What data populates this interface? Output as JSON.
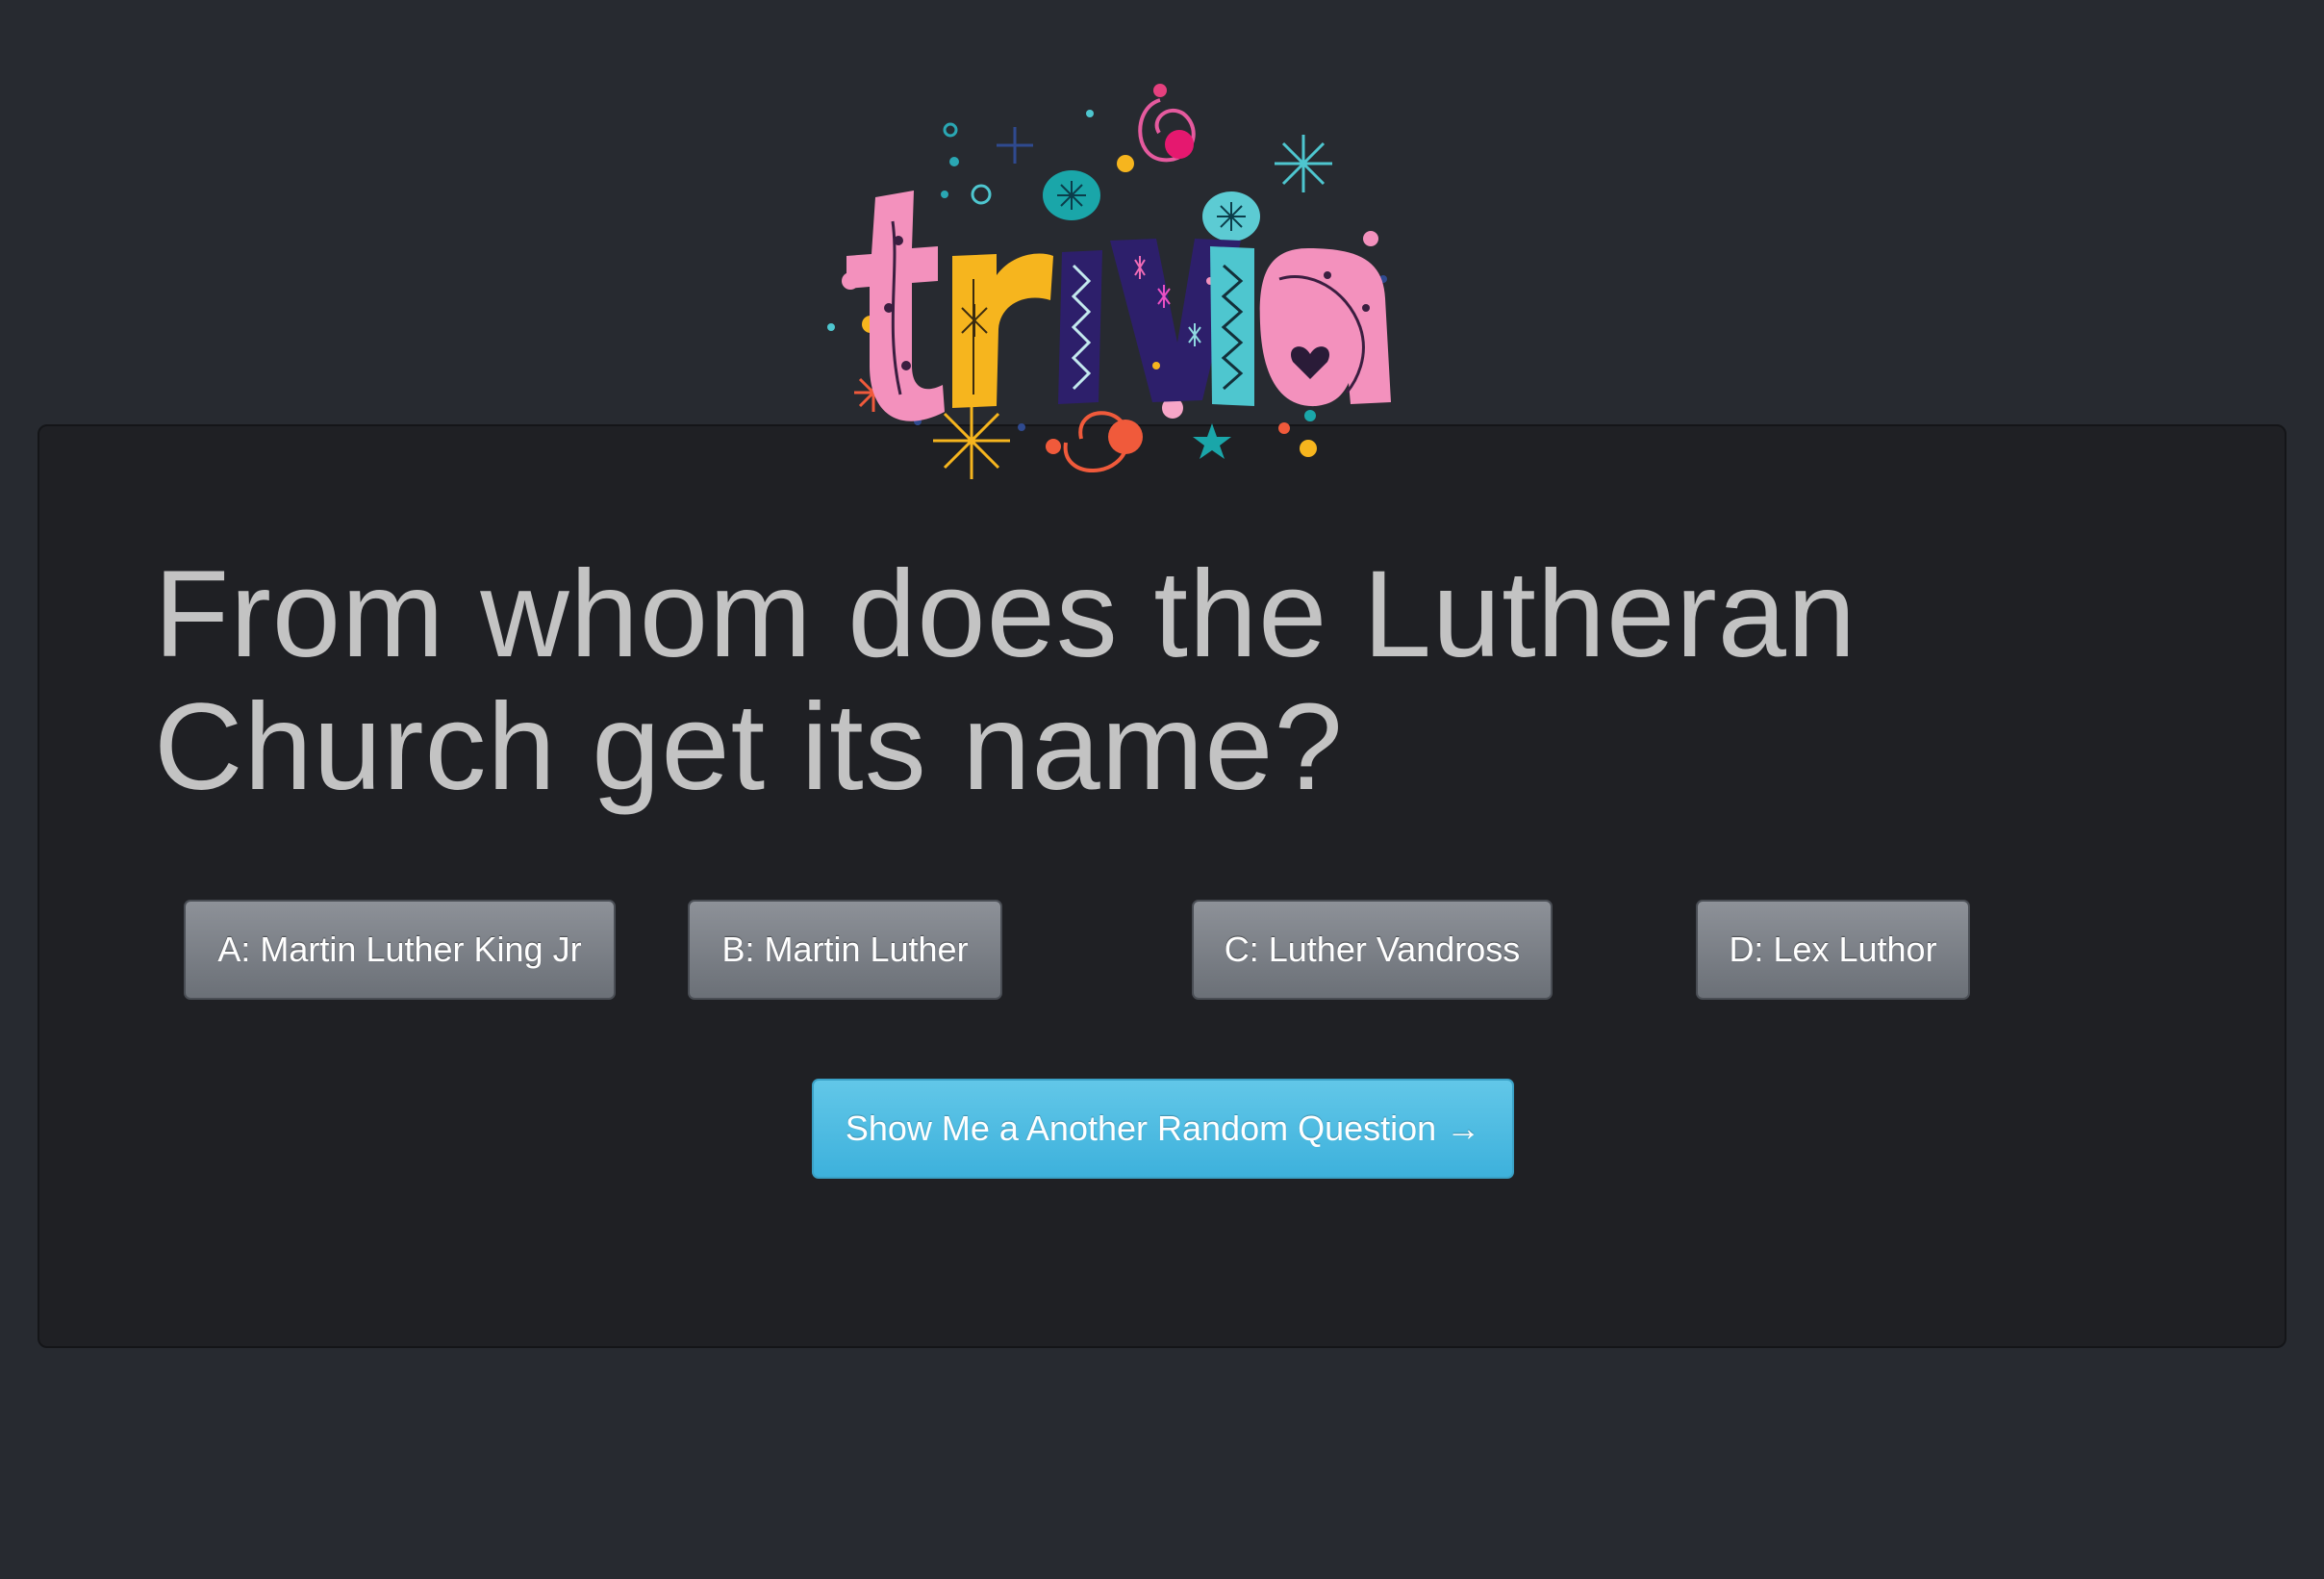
{
  "logo": {
    "text": "trivia",
    "icon": "trivia-logo",
    "letters": [
      {
        "char": "t",
        "color": "#f391bd"
      },
      {
        "char": "r",
        "color": "#f6b51e"
      },
      {
        "char": "i",
        "color": "#2d1f6b"
      },
      {
        "char": "v",
        "color": "#2d1f6b"
      },
      {
        "char": "i",
        "color": "#4ec6cf"
      },
      {
        "char": "a",
        "color": "#f391bd"
      }
    ]
  },
  "question": {
    "line1": "From whom does the Lutheran",
    "line2": "Church get its name?"
  },
  "answers": [
    {
      "label": "A: Martin Luther King Jr"
    },
    {
      "label": "B: Martin Luther"
    },
    {
      "label": "C: Luther Vandross"
    },
    {
      "label": "D: Lex Luthor"
    }
  ],
  "next_button": {
    "label": "Show Me a Another Random Question →"
  },
  "colors": {
    "page_bg": "#272a30",
    "card_bg": "#1f2024",
    "question_text": "#c3c3c3",
    "answer_button": "#7c8087",
    "primary_button": "#4dbde3"
  }
}
